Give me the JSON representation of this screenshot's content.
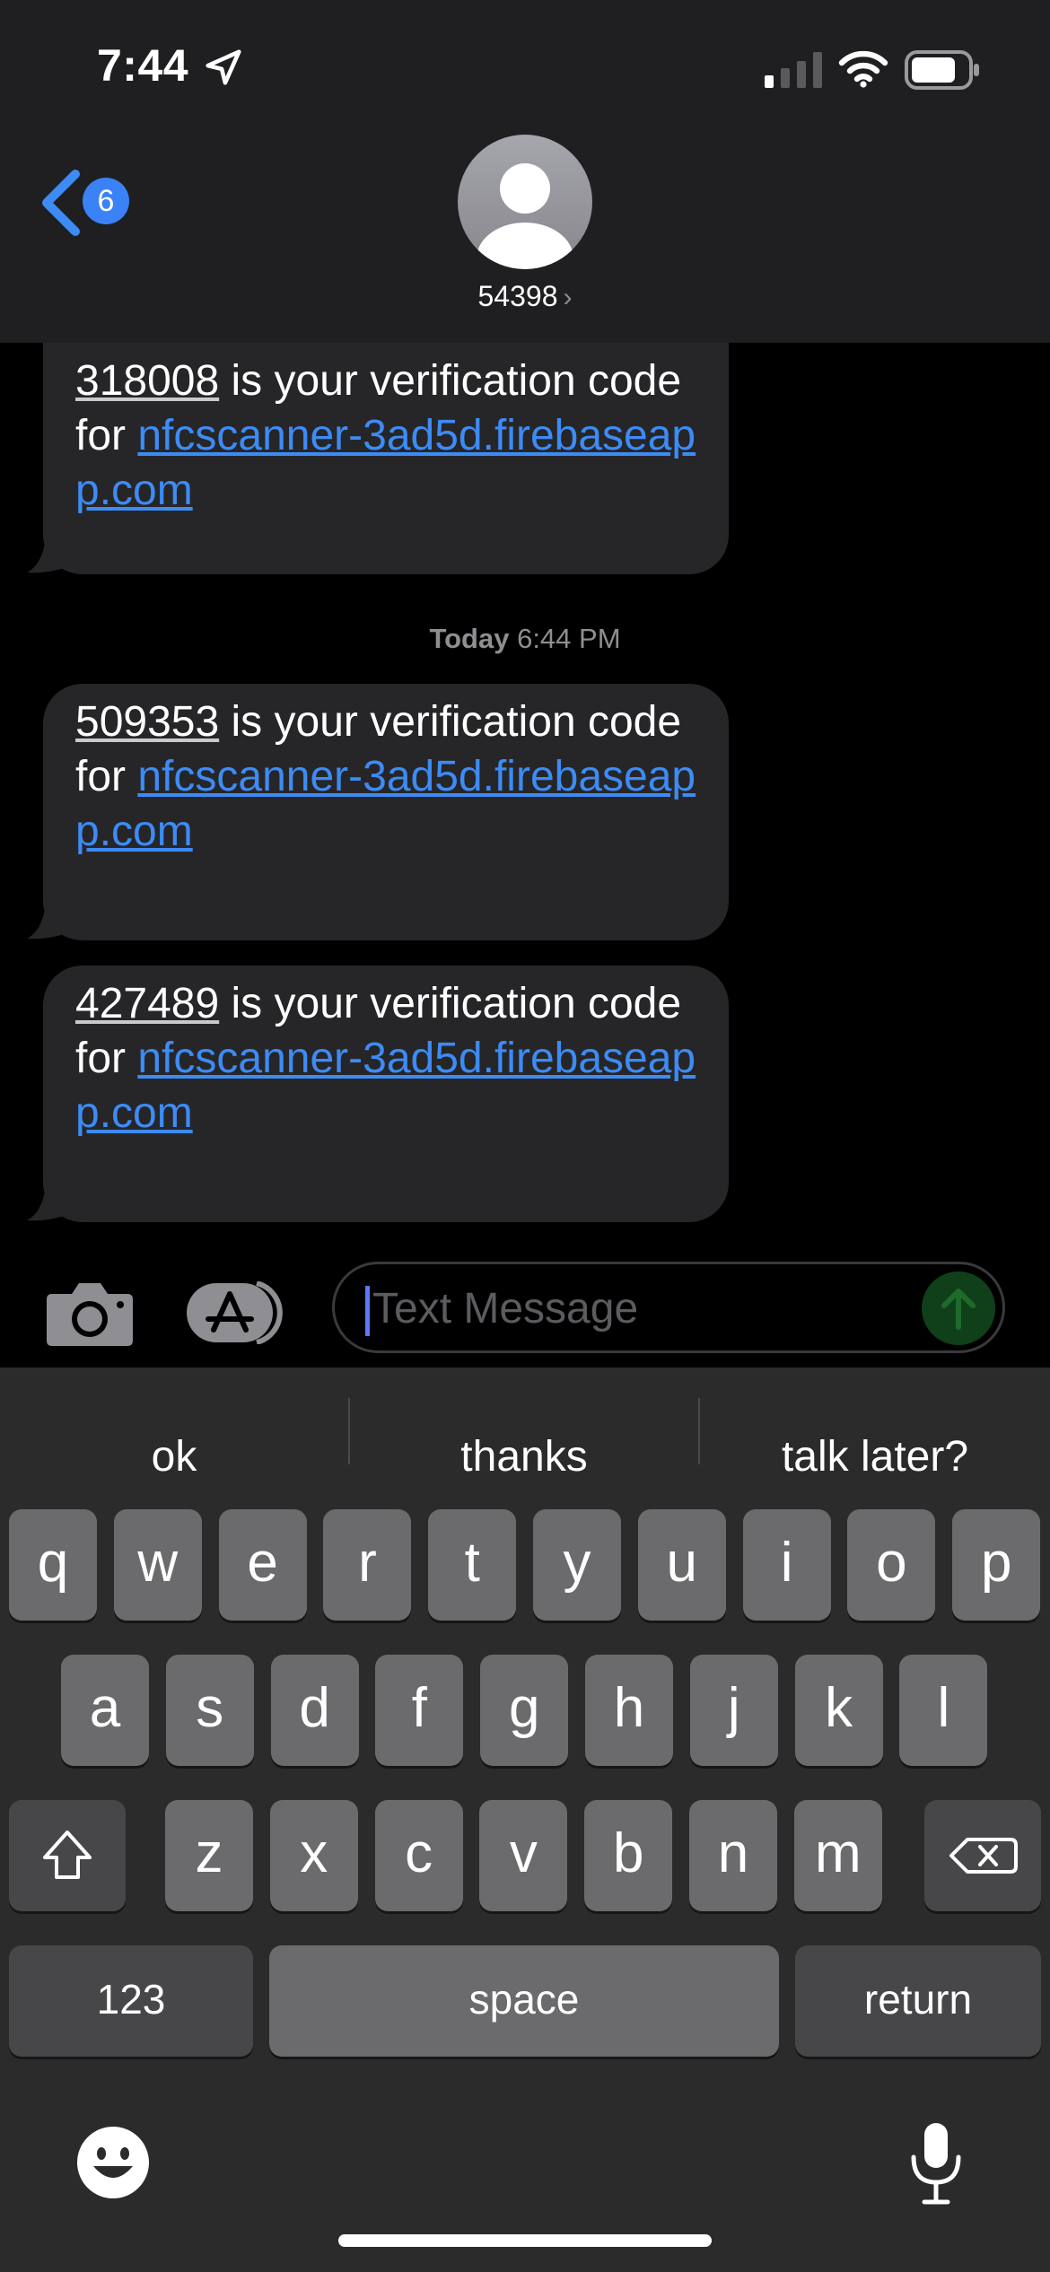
{
  "status_bar": {
    "time": "7:44",
    "icons": [
      "location-arrow-icon",
      "cellular-signal-icon",
      "wifi-icon",
      "battery-icon"
    ]
  },
  "header": {
    "back_badge": "6",
    "contact_name": "54398",
    "contact_chevron": "›"
  },
  "messages": [
    {
      "code": "318008",
      "text": " is your verification code for ",
      "link": "nfcscanner-3ad5d.firebaseapp.com"
    },
    {
      "code": "509353",
      "text": " is your verification code for ",
      "link": "nfcscanner-3ad5d.firebaseapp.com"
    },
    {
      "code": "427489",
      "text": " is your verification code for ",
      "link": "nfcscanner-3ad5d.firebaseapp.com"
    }
  ],
  "timestamp": {
    "day": "Today",
    "time": "6:44 PM"
  },
  "compose": {
    "placeholder": "Text Message"
  },
  "keyboard": {
    "suggestions": [
      "ok",
      "thanks",
      "talk later?"
    ],
    "row1": [
      "q",
      "w",
      "e",
      "r",
      "t",
      "y",
      "u",
      "i",
      "o",
      "p"
    ],
    "row2": [
      "a",
      "s",
      "d",
      "f",
      "g",
      "h",
      "j",
      "k",
      "l"
    ],
    "row3": [
      "z",
      "x",
      "c",
      "v",
      "b",
      "n",
      "m"
    ],
    "numbers_label": "123",
    "space_label": "space",
    "return_label": "return"
  },
  "colors": {
    "accent": "#3d8bf5",
    "bubble": "#262628",
    "header_bg": "#1f1f21",
    "keyboard_bg": "#2b2b2b",
    "key": "#6b6b6d",
    "key_dark": "#474749"
  }
}
